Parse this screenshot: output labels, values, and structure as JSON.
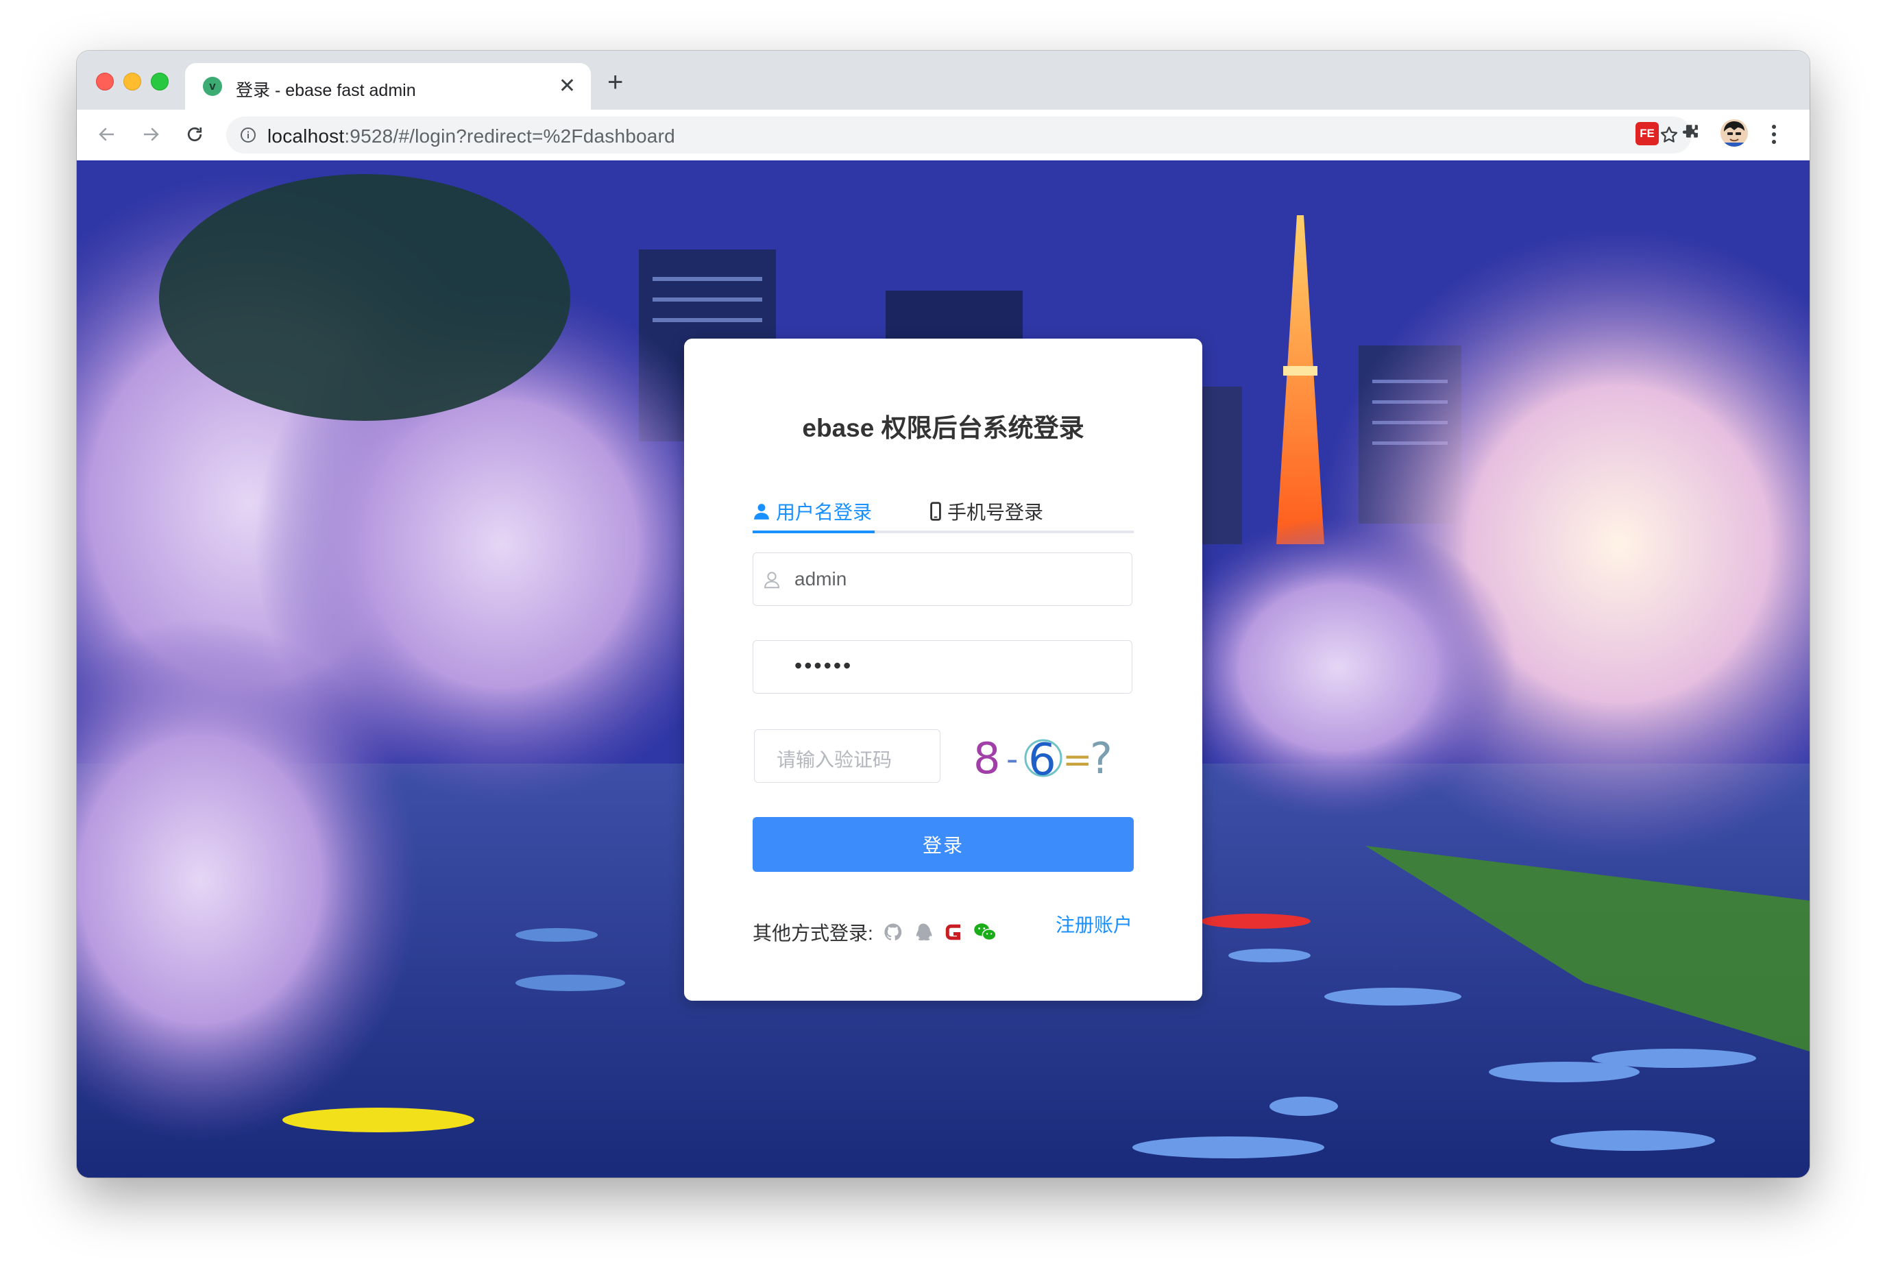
{
  "browser": {
    "tab_title": "登录 - ebase fast admin",
    "tab_favicon": "v",
    "new_tab": "+",
    "url_host": "localhost",
    "url_rest": ":9528/#/login?redirect=%2Fdashboard",
    "extension_label": "FE"
  },
  "login": {
    "title": "ebase 权限后台系统登录",
    "tab_username": "用户名登录",
    "tab_phone": "手机号登录",
    "username_value": "admin",
    "password_masked": "••••••",
    "captcha_placeholder": "请输入验证码",
    "captcha_text": "8 - 6 = ?",
    "submit_label": "登录",
    "other_login_label": "其他方式登录:",
    "register_link": "注册账户",
    "social_icons": [
      "github-icon",
      "qq-icon",
      "gitee-icon",
      "wechat-icon"
    ]
  },
  "colors": {
    "primary": "#1890ff",
    "button": "#3c8dfb",
    "tab_underline": "#1890ff"
  }
}
